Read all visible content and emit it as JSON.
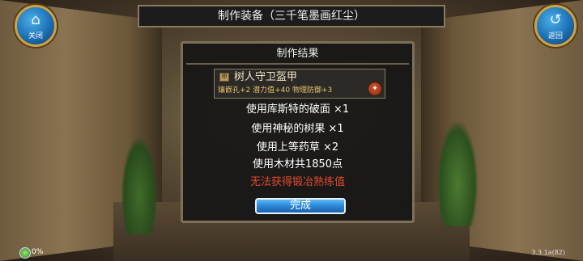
{
  "top_left_button": {
    "label": "关闭",
    "icon": "home-icon"
  },
  "top_right_button": {
    "label": "返回",
    "icon": "back-icon"
  },
  "window_title": "制作装备（三千笔墨画红尘）",
  "dialog": {
    "title": "制作结果",
    "item": {
      "name": "树人守卫盔甲",
      "attributes": "镶嵌孔+2 潜力值+40 物理防御+3",
      "icon": "armor-icon",
      "badge_icon": "gem-badge-icon"
    },
    "materials": [
      {
        "text": "使用库斯特的破面 ×1"
      },
      {
        "text": "使用神秘的树果 ×1"
      },
      {
        "text": "使用上等药草 ×2"
      },
      {
        "text": "使用木材共1850点"
      }
    ],
    "warning": "无法获得锻冶熟练值",
    "warning_color": "#e24a2e",
    "done_label": "完成"
  },
  "status": {
    "percent": "0%",
    "icon": "network-icon"
  },
  "version": "3.3.1a(82)",
  "colors": {
    "accent_blue": "#2a86d6",
    "gold_text": "#e6c36a",
    "frame": "#7d6f58"
  }
}
